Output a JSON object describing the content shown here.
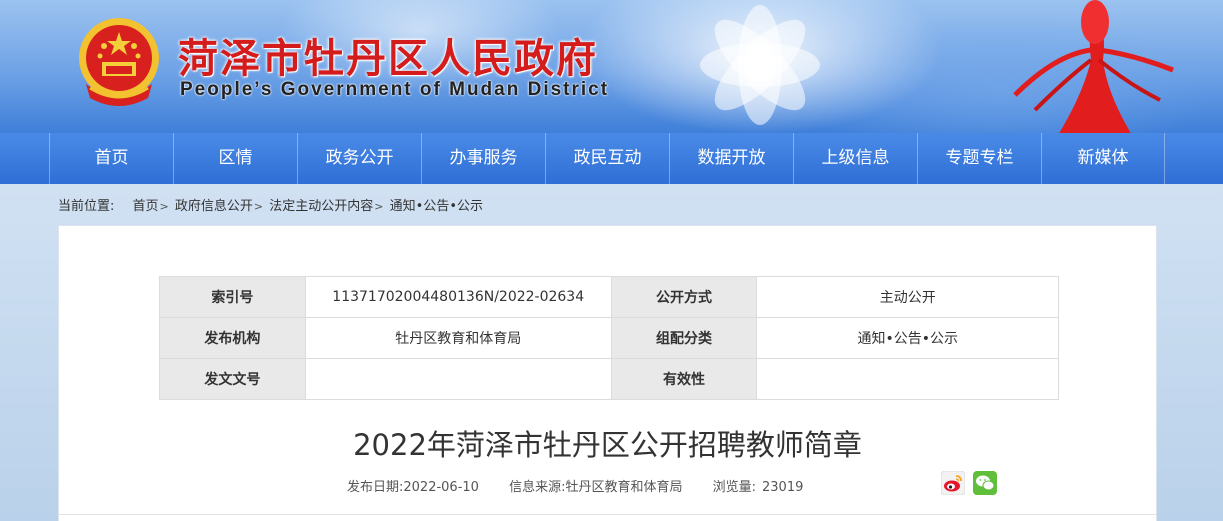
{
  "header": {
    "title": "菏泽市牡丹区人民政府",
    "subtitle": "People’s Government of Mudan District"
  },
  "nav": {
    "items": [
      "首页",
      "区情",
      "政务公开",
      "办事服务",
      "政民互动",
      "数据开放",
      "上级信息",
      "专题专栏",
      "新媒体"
    ]
  },
  "breadcrumb": {
    "label": "当前位置:",
    "items": [
      "首页",
      "政府信息公开",
      "法定主动公开内容",
      "通知•公告•公示"
    ],
    "separator": ">"
  },
  "meta": {
    "rows": [
      [
        {
          "k": "索引号",
          "v": "11371702004480136N/2022-02634"
        },
        {
          "k": "公开方式",
          "v": "主动公开"
        }
      ],
      [
        {
          "k": "发布机构",
          "v": "牡丹区教育和体育局"
        },
        {
          "k": "组配分类",
          "v": "通知•公告•公示"
        }
      ],
      [
        {
          "k": "发文文号",
          "v": ""
        },
        {
          "k": "有效性",
          "v": ""
        }
      ]
    ]
  },
  "article": {
    "title": "2022年菏泽市牡丹区公开招聘教师简章",
    "publish_date": "发布日期:2022-06-10",
    "source": "信息来源:牡丹区教育和体育局",
    "views_label": "浏览量:",
    "views": "23019"
  },
  "icons": {
    "share_weibo": "weibo-icon",
    "share_wechat": "wechat-icon"
  },
  "colors": {
    "title_red": "#d41c1c",
    "nav_blue": "#2f6fd6"
  }
}
